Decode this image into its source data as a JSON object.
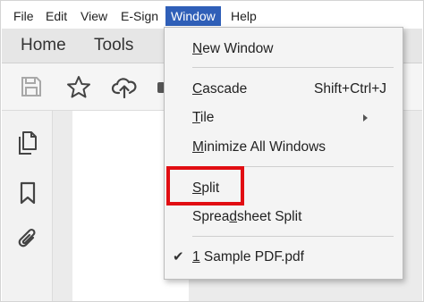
{
  "menubar": {
    "items": [
      {
        "label": "File"
      },
      {
        "label": "Edit"
      },
      {
        "label": "View"
      },
      {
        "label": "E-Sign"
      },
      {
        "label": "Window"
      },
      {
        "label": "Help"
      }
    ],
    "active": "Window"
  },
  "tabs": [
    {
      "label": "Home"
    },
    {
      "label": "Tools"
    }
  ],
  "toolbar": {
    "icons": [
      "save-icon",
      "star-icon",
      "cloud-upload-icon",
      "print-icon"
    ]
  },
  "leftrail": {
    "icons": [
      "pages-icon",
      "bookmark-icon",
      "attachment-icon"
    ]
  },
  "window_menu": {
    "new_window": {
      "pre": "",
      "ul": "N",
      "post": "ew Window"
    },
    "cascade": {
      "pre": "",
      "ul": "C",
      "post": "ascade",
      "shortcut": "Shift+Ctrl+J"
    },
    "tile": {
      "pre": "",
      "ul": "T",
      "post": "ile"
    },
    "minimize_all": {
      "pre": "",
      "ul": "M",
      "post": "inimize All Windows"
    },
    "split": {
      "pre": "",
      "ul": "S",
      "post": "plit"
    },
    "spreadsheet_split": {
      "pre": "Sprea",
      "ul": "d",
      "post": "sheet Split"
    },
    "open_document": {
      "pre": "",
      "ul": "1",
      "post": " Sample PDF.pdf"
    }
  },
  "colors": {
    "active_menu": "#2f5fb8",
    "highlight_box": "#e10d12"
  }
}
